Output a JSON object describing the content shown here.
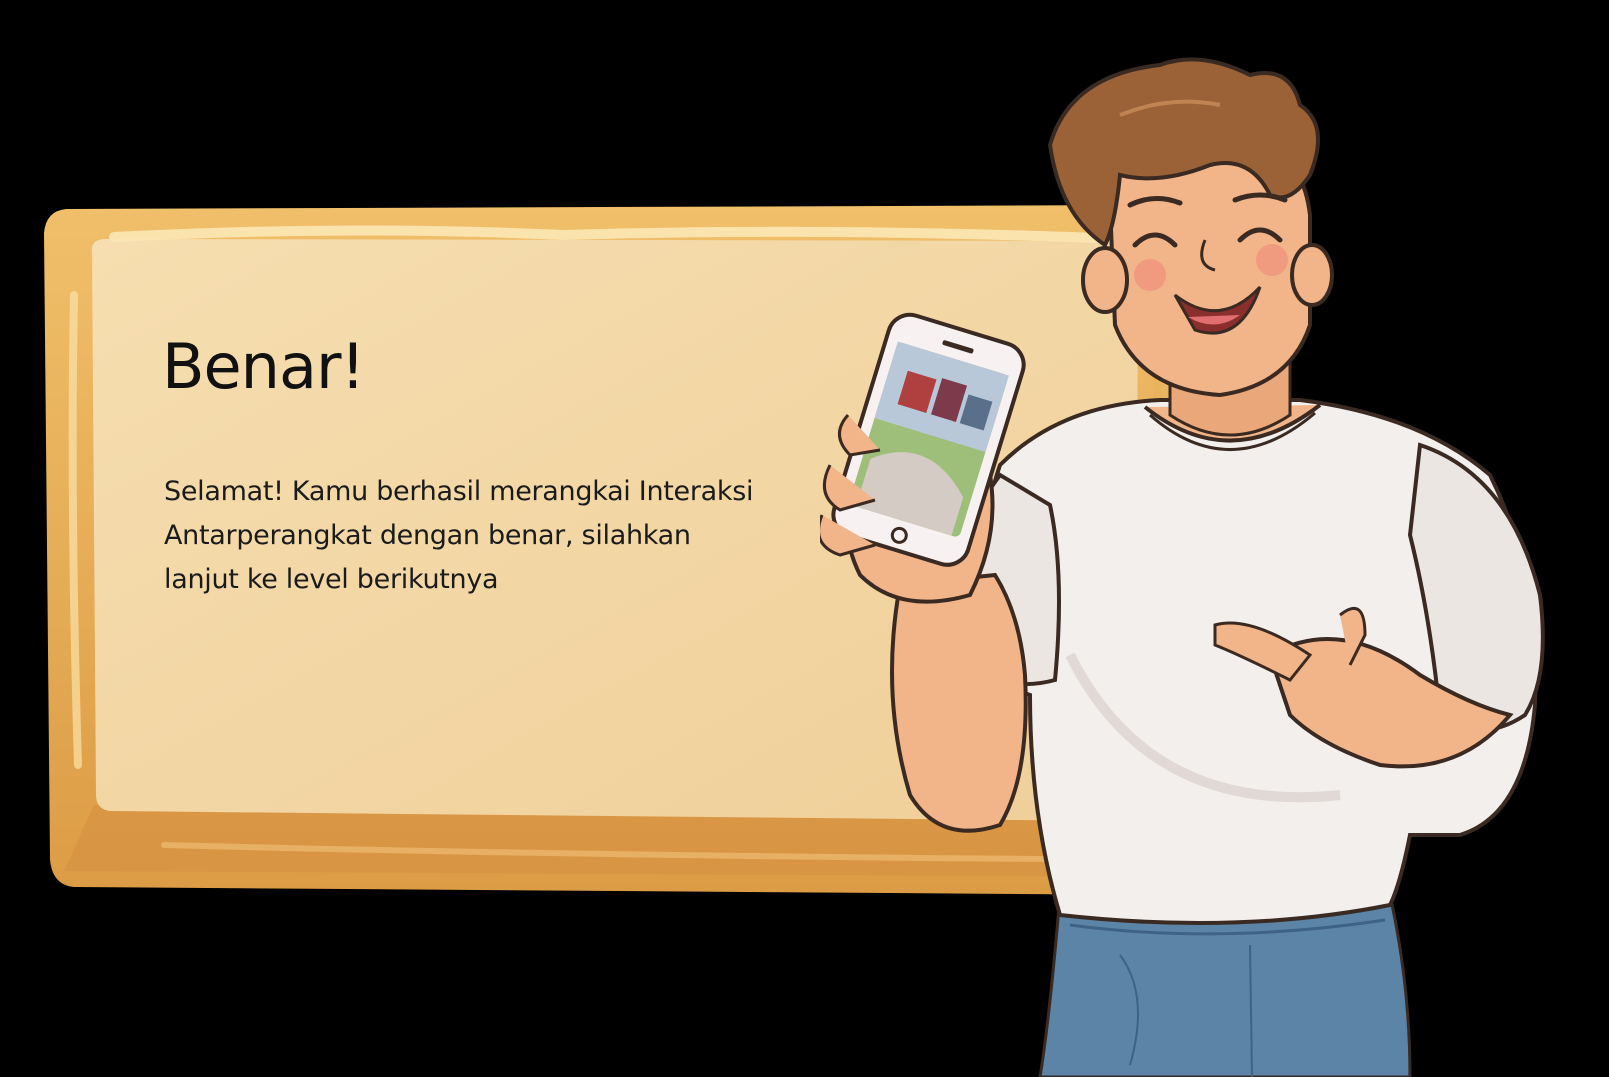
{
  "dialog": {
    "title": "Benar!",
    "message": "Selamat! Kamu berhasil merangkai Interaksi Antarperangkat dengan benar, silahkan lanjut ke level berikutnya"
  },
  "illustration": {
    "character": "smiling-man-holding-phone-pointing-icon",
    "phone_screen": "game-scene-icon"
  },
  "colors": {
    "background": "#000000",
    "panel_frame": "#e6a94e",
    "panel_fill": "#f2d6a8",
    "panel_highlight": "#fbe7b5",
    "title_text": "#111111",
    "body_text": "#1b1b1b",
    "shirt": "#f2efed",
    "skin": "#f1b589",
    "hair": "#9b6238",
    "jeans": "#5b84a6"
  }
}
